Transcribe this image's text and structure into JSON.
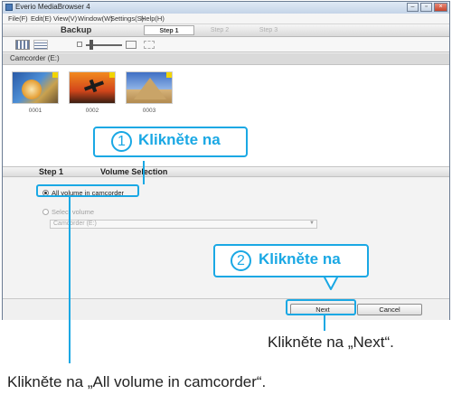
{
  "window": {
    "title": "Everio MediaBrowser 4"
  },
  "menu": [
    "File(F)",
    "Edit(E)",
    "View(V)",
    "Window(W)",
    "Settings(S)",
    "Help(H)"
  ],
  "steps": {
    "mode": "Backup",
    "tabs": [
      "Step 1",
      "Step 2",
      "Step 3"
    ]
  },
  "device": {
    "label": "Camcorder (E:)"
  },
  "thumbnails": [
    {
      "number": "0001"
    },
    {
      "number": "0002"
    },
    {
      "number": "0003"
    }
  ],
  "step1": {
    "step": "Step 1",
    "title": "Volume Selection"
  },
  "options": {
    "all_volume": "All volume in camcorder",
    "select_volume": "Select volume",
    "dropdown_value": "Camcorder (E:)"
  },
  "buttons": {
    "next": "Next",
    "cancel": "Cancel"
  },
  "callouts": {
    "one_number": "1",
    "one_text": "Klikněte na",
    "two_number": "2",
    "two_text": "Klikněte na"
  },
  "annotations": {
    "next": "Klikněte na „Next“.",
    "all_volume": "Klikněte na „All volume in camcorder“."
  },
  "colors": {
    "accent": "#1aa8e4",
    "background": "#f0f0f0",
    "sun": "#f2d500"
  }
}
